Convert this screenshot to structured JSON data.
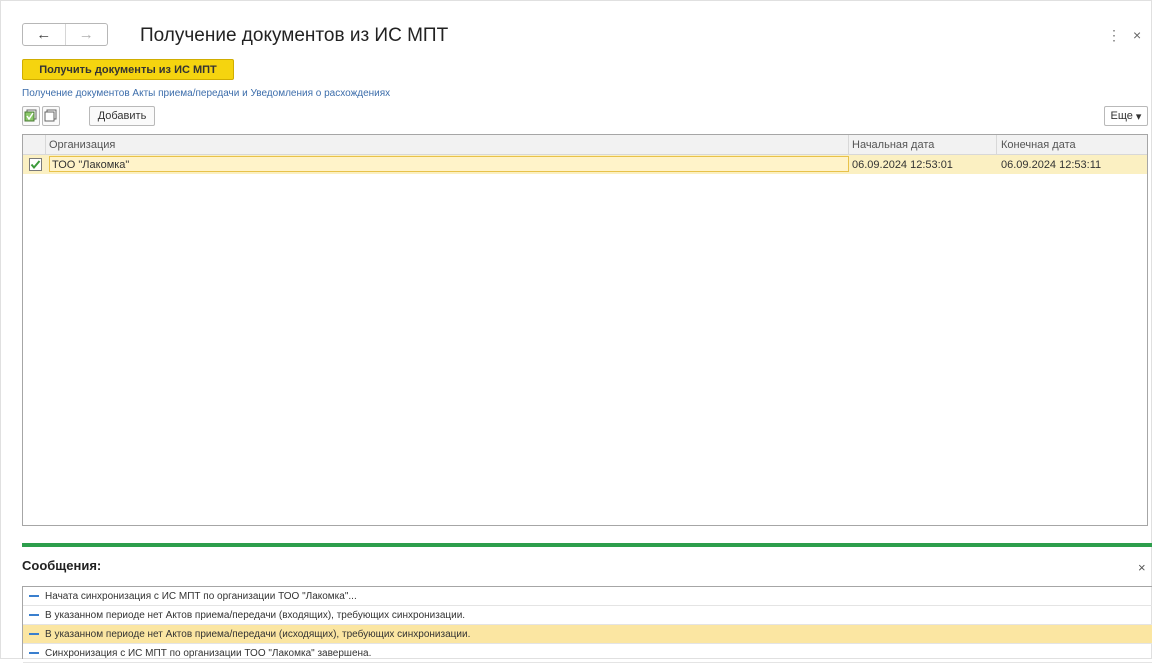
{
  "window": {
    "title": "Получение документов из ИС МПТ",
    "back_icon": "←",
    "forward_icon": "→",
    "more_icon": "⋮",
    "close_icon": "×"
  },
  "actions": {
    "primary_label": "Получить документы из ИС МПТ",
    "link_text": "Получение документов Акты приема/передачи и Уведомления о расхождениях",
    "add_label": "Добавить",
    "more_label": "Еще",
    "more_arrow": "▾"
  },
  "table": {
    "columns": [
      "Организация",
      "Начальная дата",
      "Конечная дата"
    ],
    "rows": [
      {
        "checked": true,
        "organization": "ТОО \"Лакомка\"",
        "start_date": "06.09.2024 12:53:01",
        "end_date": "06.09.2024 12:53:11"
      }
    ]
  },
  "messages": {
    "title": "Сообщения:",
    "close_icon": "×",
    "items": [
      "Начата синхронизация с ИС МПТ по организации ТОО \"Лакомка\"...",
      "В указанном периоде нет Актов приема/передачи (входящих), требующих синхронизации.",
      "В указанном периоде нет Актов приема/передачи (исходящих), требующих синхронизации.",
      "Синхронизация с ИС МПТ по организации ТОО \"Лакомка\" завершена."
    ],
    "selected_index": 2
  },
  "colors": {
    "accent_yellow": "#f5d40f",
    "selection": "#fbf0c2",
    "divider_green": "#2d9e4c",
    "link_blue": "#3c6dab"
  }
}
